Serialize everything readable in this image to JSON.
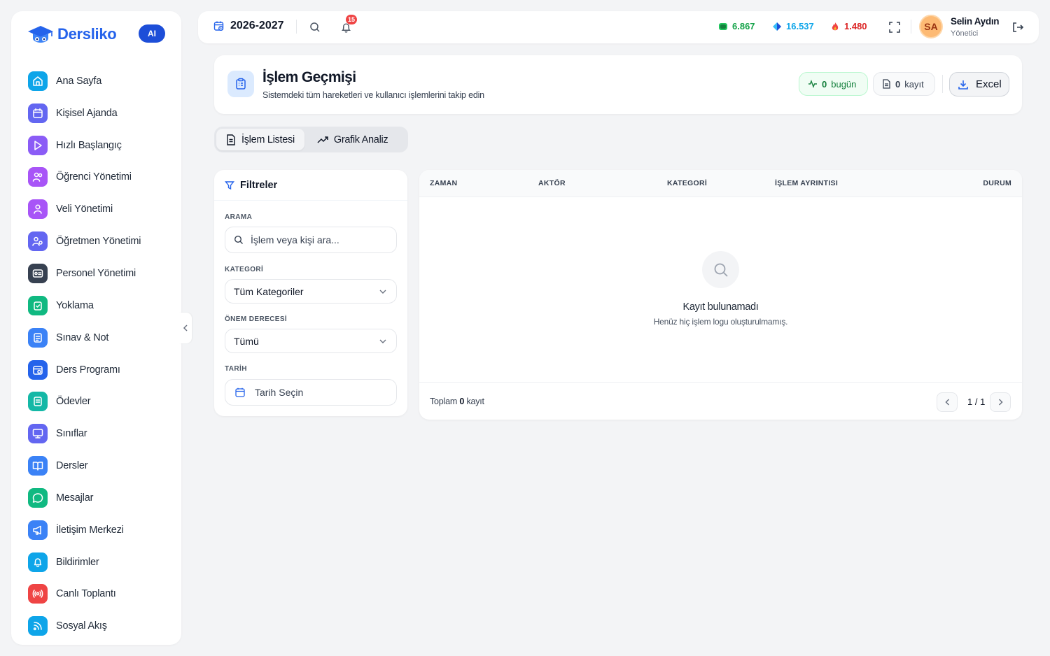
{
  "brand": {
    "name": "Dersliko",
    "ai_badge": "AI"
  },
  "sidebar": {
    "items": [
      {
        "label": "Ana Sayfa",
        "color": "#0ea5e9"
      },
      {
        "label": "Kişisel Ajanda",
        "color": "#6366f1"
      },
      {
        "label": "Hızlı Başlangıç",
        "color": "#8b5cf6"
      },
      {
        "label": "Öğrenci Yönetimi",
        "color": "#a855f7"
      },
      {
        "label": "Veli Yönetimi",
        "color": "#a855f7"
      },
      {
        "label": "Öğretmen Yönetimi",
        "color": "#6366f1"
      },
      {
        "label": "Personel Yönetimi",
        "color": "#374151"
      },
      {
        "label": "Yoklama",
        "color": "#10b981"
      },
      {
        "label": "Sınav & Not",
        "color": "#3b82f6"
      },
      {
        "label": "Ders Programı",
        "color": "#2563eb"
      },
      {
        "label": "Ödevler",
        "color": "#14b8a6"
      },
      {
        "label": "Sınıflar",
        "color": "#6366f1"
      },
      {
        "label": "Dersler",
        "color": "#3b82f6"
      },
      {
        "label": "Mesajlar",
        "color": "#10b981"
      },
      {
        "label": "İletişim Merkezi",
        "color": "#3b82f6"
      },
      {
        "label": "Bildirimler",
        "color": "#0ea5e9"
      },
      {
        "label": "Canlı Toplantı",
        "color": "#ef4444"
      },
      {
        "label": "Sosyal Akış",
        "color": "#0ea5e9"
      }
    ]
  },
  "topbar": {
    "year": "2026-2027",
    "notification_count": "15",
    "stats": [
      {
        "value": "6.867",
        "color": "#16a34a"
      },
      {
        "value": "16.537",
        "color": "#0ea5e9"
      },
      {
        "value": "1.480",
        "color": "#dc2626"
      }
    ],
    "user": {
      "initials": "SA",
      "name": "Selin Aydın",
      "role": "Yönetici"
    }
  },
  "header": {
    "title": "İşlem Geçmişi",
    "subtitle": "Sistemdeki tüm hareketleri ve kullanıcı işlemlerini takip edin",
    "today_count": "0",
    "today_label": "bugün",
    "record_count": "0",
    "record_label": "kayıt",
    "excel_label": "Excel"
  },
  "tabs": [
    {
      "label": "İşlem Listesi",
      "active": true
    },
    {
      "label": "Grafik Analiz",
      "active": false
    }
  ],
  "filters": {
    "title": "Filtreler",
    "search_label": "ARAMA",
    "search_placeholder": "İşlem veya kişi ara...",
    "category_label": "KATEGORİ",
    "category_value": "Tüm Kategoriler",
    "priority_label": "ÖNEM DERECESİ",
    "priority_value": "Tümü",
    "date_label": "TARİH",
    "date_placeholder": "Tarih Seçin"
  },
  "table": {
    "columns": [
      "ZAMAN",
      "AKTÖR",
      "KATEGORİ",
      "İŞLEM AYRINTISI",
      "DURUM"
    ],
    "empty_title": "Kayıt bulunamadı",
    "empty_subtitle": "Henüz hiç işlem logu oluşturulmamış.",
    "total_prefix": "Toplam",
    "total_count": "0",
    "total_suffix": "kayıt",
    "page": "1 / 1"
  }
}
